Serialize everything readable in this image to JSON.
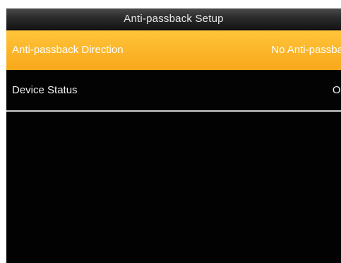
{
  "screen": {
    "title": "Anti-passback Setup"
  },
  "menu": {
    "items": [
      {
        "label": "Anti-passback  Direction",
        "value": "No Anti-passback",
        "selected": true
      },
      {
        "label": "Device Status",
        "value": "Out",
        "selected": false
      }
    ]
  },
  "colors": {
    "selected_row": "#fcb62a",
    "background": "#020202",
    "title_bar": "#2a2a2a",
    "text": "#ffffff"
  }
}
